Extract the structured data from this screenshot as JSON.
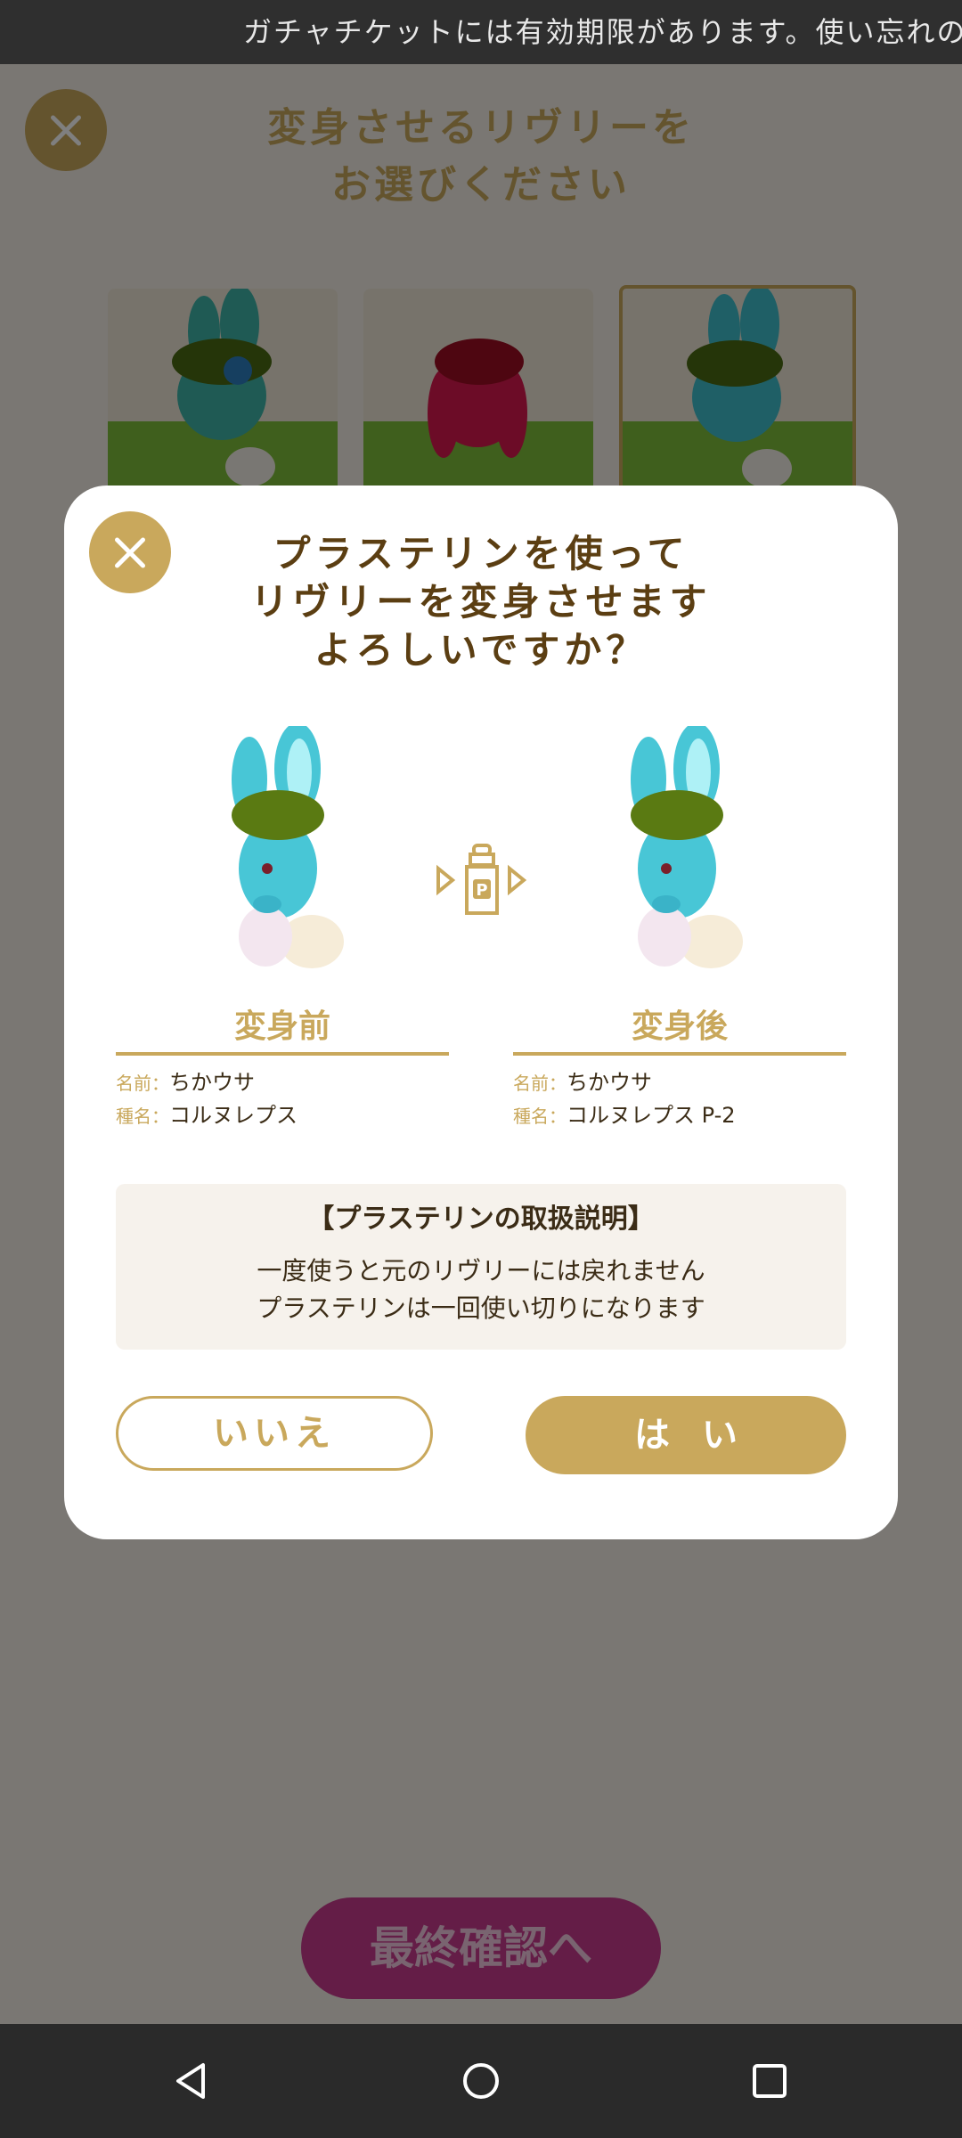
{
  "ticker": {
    "text": "ガチャチケットには有効期限があります。使い忘れの"
  },
  "background_screen": {
    "title_line1": "変身させるリヴリーを",
    "title_line2": "お選びください",
    "final_button": "最終確認へ"
  },
  "dialog": {
    "title_line1": "プラステリンを使って",
    "title_line2": "リヴリーを変身させます",
    "title_line3": "よろしいですか？",
    "before": {
      "heading": "変身前",
      "name_key": "名前：",
      "name_value": "ちかウサ",
      "species_key": "種名：",
      "species_value": "コルヌレプス"
    },
    "after": {
      "heading": "変身後",
      "name_key": "名前：",
      "name_value": "ちかウサ",
      "species_key": "種名：",
      "species_value": "コルヌレプス P-2"
    },
    "notice": {
      "title": "【プラステリンの取扱説明】",
      "line1": "一度使うと元のリヴリーには戻れません",
      "line2": "プラステリンは一回使い切りになります"
    },
    "no_button": "いいえ",
    "yes_button": "はい"
  },
  "colors": {
    "accent_gold": "#c9a85c",
    "title_brown": "#5b3e12",
    "final_button_pink": "#c93a8f"
  }
}
